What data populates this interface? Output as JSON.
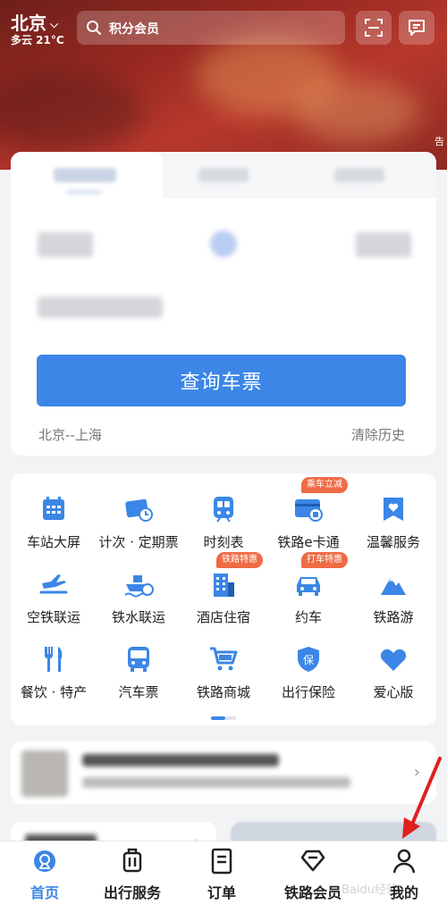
{
  "header": {
    "city": "北京",
    "weather": "多云 21°C",
    "search_placeholder": "积分会员",
    "side_tag": "告"
  },
  "ticket_card": {
    "query_button": "查询车票",
    "history": "北京--上海",
    "clear_history": "清除历史"
  },
  "services": [
    {
      "label": "车站大屏",
      "icon": "station-screen-icon"
    },
    {
      "label": "计次 · 定期票",
      "icon": "ticket-pass-icon"
    },
    {
      "label": "时刻表",
      "icon": "train-timetable-icon"
    },
    {
      "label": "铁路e卡通",
      "icon": "rail-ecard-icon",
      "badge": "乘车立减"
    },
    {
      "label": "温馨服务",
      "icon": "heart-service-icon"
    },
    {
      "label": "空铁联运",
      "icon": "plane-rail-icon"
    },
    {
      "label": "铁水联运",
      "icon": "ship-rail-icon"
    },
    {
      "label": "酒店住宿",
      "icon": "hotel-icon",
      "badge": "铁路特惠"
    },
    {
      "label": "约车",
      "icon": "car-icon",
      "badge": "打车特惠"
    },
    {
      "label": "铁路游",
      "icon": "mountain-tour-icon"
    },
    {
      "label": "餐饮 · 特产",
      "icon": "fork-knife-icon"
    },
    {
      "label": "汽车票",
      "icon": "bus-icon"
    },
    {
      "label": "铁路商城",
      "icon": "shopping-cart-icon"
    },
    {
      "label": "出行保险",
      "icon": "insurance-shield-icon"
    },
    {
      "label": "爱心版",
      "icon": "heart-icon"
    }
  ],
  "tabbar": [
    {
      "label": "首页",
      "icon": "home-icon",
      "active": true
    },
    {
      "label": "出行服务",
      "icon": "luggage-icon"
    },
    {
      "label": "订单",
      "icon": "order-doc-icon"
    },
    {
      "label": "铁路会员",
      "icon": "diamond-icon"
    },
    {
      "label": "我的",
      "icon": "person-icon"
    }
  ],
  "watermark": "Baidu经验",
  "colors": {
    "accent": "#3b86e6",
    "badge": "#ef6b45",
    "banner": "#9a2a22",
    "annotation_arrow": "#e02020"
  }
}
